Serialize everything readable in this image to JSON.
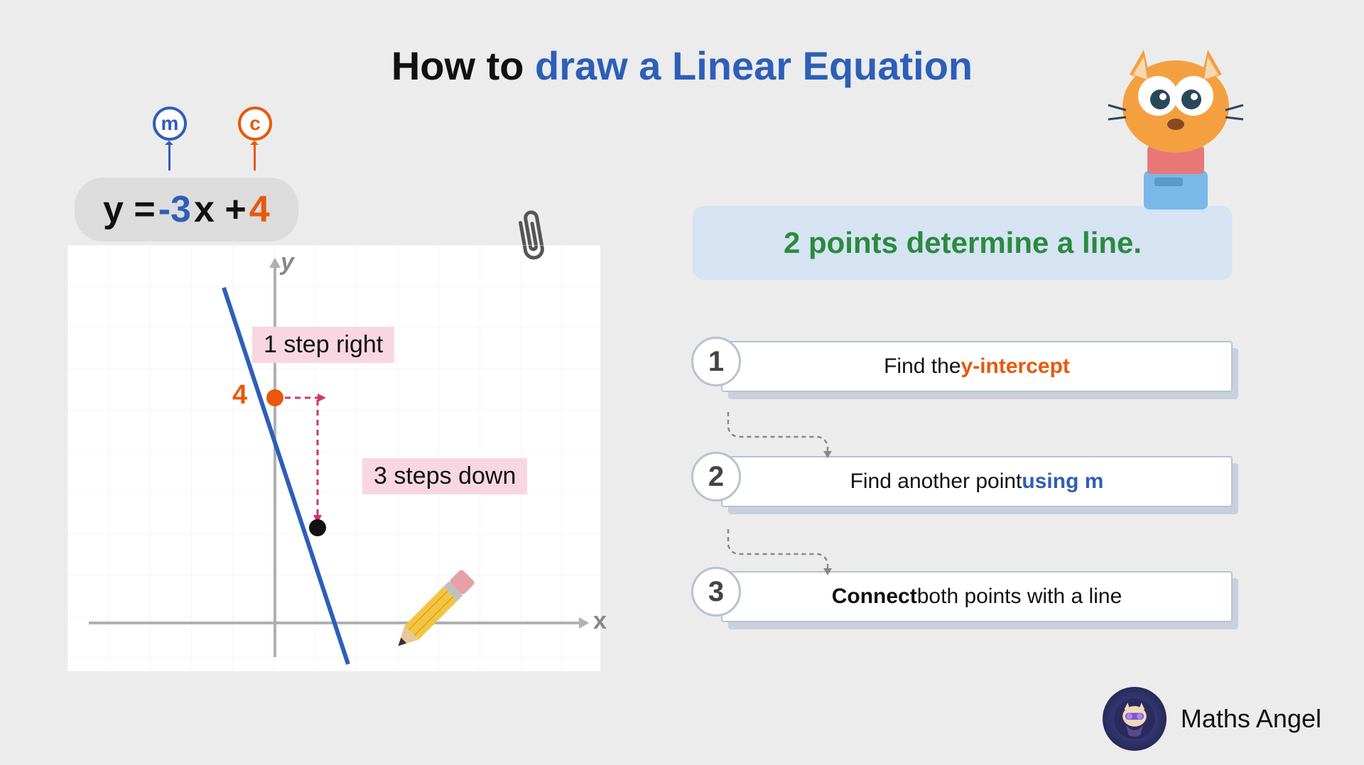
{
  "title": {
    "part1": "How to ",
    "part2": "draw a Linear Equation"
  },
  "badges": {
    "m": "m",
    "c": "c"
  },
  "equation": {
    "y": "y = ",
    "m": "-3",
    "x": "x +",
    "c": "4"
  },
  "graph": {
    "y_label": "y",
    "x_label": "x",
    "intercept_label": "4",
    "step_right": "1 step right",
    "step_down": "3 steps down"
  },
  "banner": "2 points determine a line.",
  "steps": [
    {
      "num": "1",
      "pre": "Find the ",
      "hl": "y-intercept",
      "post": "",
      "hl_class": "t-orange"
    },
    {
      "num": "2",
      "pre": "Find another point ",
      "hl": "using m",
      "post": "",
      "hl_class": "t-blue"
    },
    {
      "num": "3",
      "pre_bold": "Connect",
      "post": " both points with a line"
    }
  ],
  "brand": "Maths Angel"
}
